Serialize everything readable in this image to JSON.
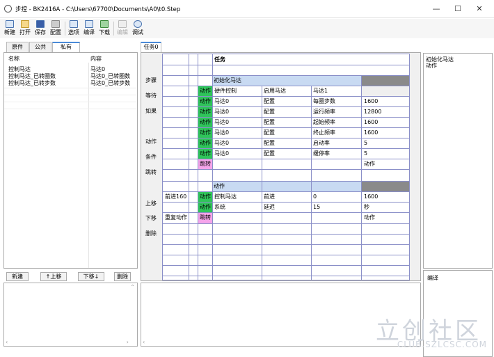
{
  "window": {
    "app_name": "步控",
    "separator": "-",
    "doc_name": "BK2416A",
    "path": "C:\\Users\\67700\\Documents\\A0\\t0.Step",
    "minimize": "—",
    "maximize": "☐",
    "close": "✕"
  },
  "toolbar": {
    "new": "新建",
    "open": "打开",
    "save": "保存",
    "config": "配置",
    "options": "选项",
    "compile": "编译",
    "download": "下载",
    "edit": "编辑",
    "debug": "调试"
  },
  "left_tabs": [
    "原件",
    "公共",
    "私有"
  ],
  "left_table": {
    "headers": [
      "名称",
      "内容"
    ],
    "rows": [
      [
        "控制马达",
        "马达0"
      ],
      [
        "控制马达_已转圈数",
        "马达0_已转圈数"
      ],
      [
        "控制马达_已转步数",
        "马达0_已转步数"
      ]
    ]
  },
  "left_buttons": {
    "new": "新建",
    "up": "↑上移",
    "down": "下移↓",
    "delete": "删除"
  },
  "center_tab": "任务0",
  "side_buttons": {
    "step": "步骤",
    "wait": "等待",
    "if": "如果",
    "action": "动作",
    "cond": "条件",
    "jump": "跳转",
    "up": "上移",
    "down": "下移",
    "del": "删除"
  },
  "grid": {
    "task_header": "任务",
    "block1_title": "初始化马达",
    "block1_rows": [
      [
        "动作",
        "硬件控制",
        "启用马达",
        "马达1",
        ""
      ],
      [
        "动作",
        "马达0",
        "配置",
        "每圈步数",
        "1600"
      ],
      [
        "动作",
        "马达0",
        "配置",
        "运行频率",
        "12800"
      ],
      [
        "动作",
        "马达0",
        "配置",
        "起始频率",
        "1600"
      ],
      [
        "动作",
        "马达0",
        "配置",
        "终止频率",
        "1600"
      ],
      [
        "动作",
        "马达0",
        "配置",
        "启动率",
        "5"
      ],
      [
        "动作",
        "马达0",
        "配置",
        "缓停率",
        "5"
      ]
    ],
    "block1_jump": "跳转",
    "block1_jump_target": "动作",
    "block2_title": "动作",
    "block2_row1": [
      "前进160",
      "动作",
      "控制马达",
      "前进",
      "0",
      "1600"
    ],
    "block2_row2": [
      "动作",
      "系统",
      "延迟",
      "15",
      "秒"
    ],
    "block2_row3": [
      "重复动作",
      "跳转",
      "动作"
    ]
  },
  "right_panel": {
    "line1": "初始化马达",
    "line2": "动作"
  },
  "right_bottom": {
    "label": "编译"
  },
  "watermark": {
    "main": "立创社区",
    "sub": "CLUB.SZLCSC.COM"
  }
}
